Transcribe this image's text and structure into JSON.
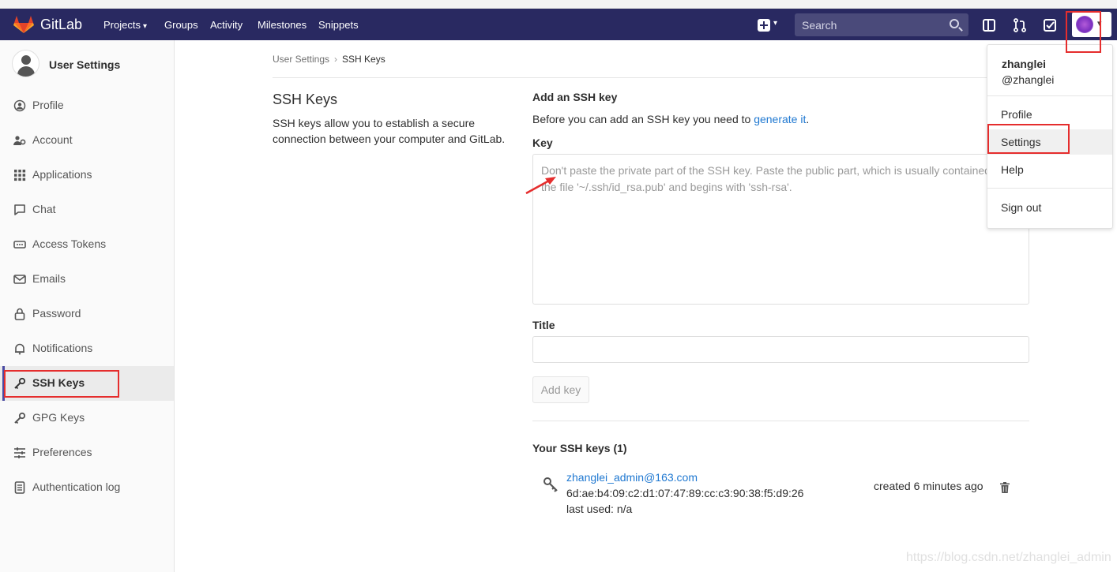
{
  "navbar": {
    "brand": "GitLab",
    "projects": "Projects",
    "groups": "Groups",
    "activity": "Activity",
    "milestones": "Milestones",
    "snippets": "Snippets",
    "search_placeholder": "Search"
  },
  "sidebar": {
    "title": "User Settings",
    "items": [
      {
        "label": "Profile",
        "icon": "profile-icon"
      },
      {
        "label": "Account",
        "icon": "account-icon"
      },
      {
        "label": "Applications",
        "icon": "applications-icon"
      },
      {
        "label": "Chat",
        "icon": "chat-icon"
      },
      {
        "label": "Access Tokens",
        "icon": "access-tokens-icon"
      },
      {
        "label": "Emails",
        "icon": "emails-icon"
      },
      {
        "label": "Password",
        "icon": "lock-icon"
      },
      {
        "label": "Notifications",
        "icon": "bell-icon"
      },
      {
        "label": "SSH Keys",
        "icon": "key-icon"
      },
      {
        "label": "GPG Keys",
        "icon": "key-icon"
      },
      {
        "label": "Preferences",
        "icon": "preferences-icon"
      },
      {
        "label": "Authentication log",
        "icon": "log-icon"
      }
    ],
    "active": "SSH Keys"
  },
  "breadcrumb": {
    "parent": "User Settings",
    "current": "SSH Keys"
  },
  "section": {
    "title": "SSH Keys",
    "description": "SSH keys allow you to establish a secure connection between your computer and GitLab."
  },
  "form": {
    "heading": "Add an SSH key",
    "hint_prefix": "Before you can add an SSH key you need to ",
    "hint_link": "generate it",
    "hint_suffix": ".",
    "key_label": "Key",
    "key_placeholder": "Don't paste the private part of the SSH key. Paste the public part, which is usually contained in the file '~/.ssh/id_rsa.pub' and begins with 'ssh-rsa'.",
    "title_label": "Title",
    "title_value": "",
    "add_button": "Add key"
  },
  "keys": {
    "heading": "Your SSH keys (1)",
    "list": [
      {
        "title": "zhanglei_admin@163.com",
        "fingerprint": "6d:ae:b4:09:c2:d1:07:47:89:cc:c3:90:38:f5:d9:26",
        "last_used": "last used: n/a",
        "created": "created 6 minutes ago"
      }
    ]
  },
  "user_menu": {
    "name": "zhanglei",
    "handle": "@zhanglei",
    "items": [
      "Profile",
      "Settings",
      "Help",
      "Sign out"
    ]
  },
  "watermark": "https://blog.csdn.net/zhanglei_admin",
  "colors": {
    "navbar": "#292961",
    "link": "#1f78d1",
    "annotation": "#e52d2d",
    "brand_orange": "#e24329"
  }
}
